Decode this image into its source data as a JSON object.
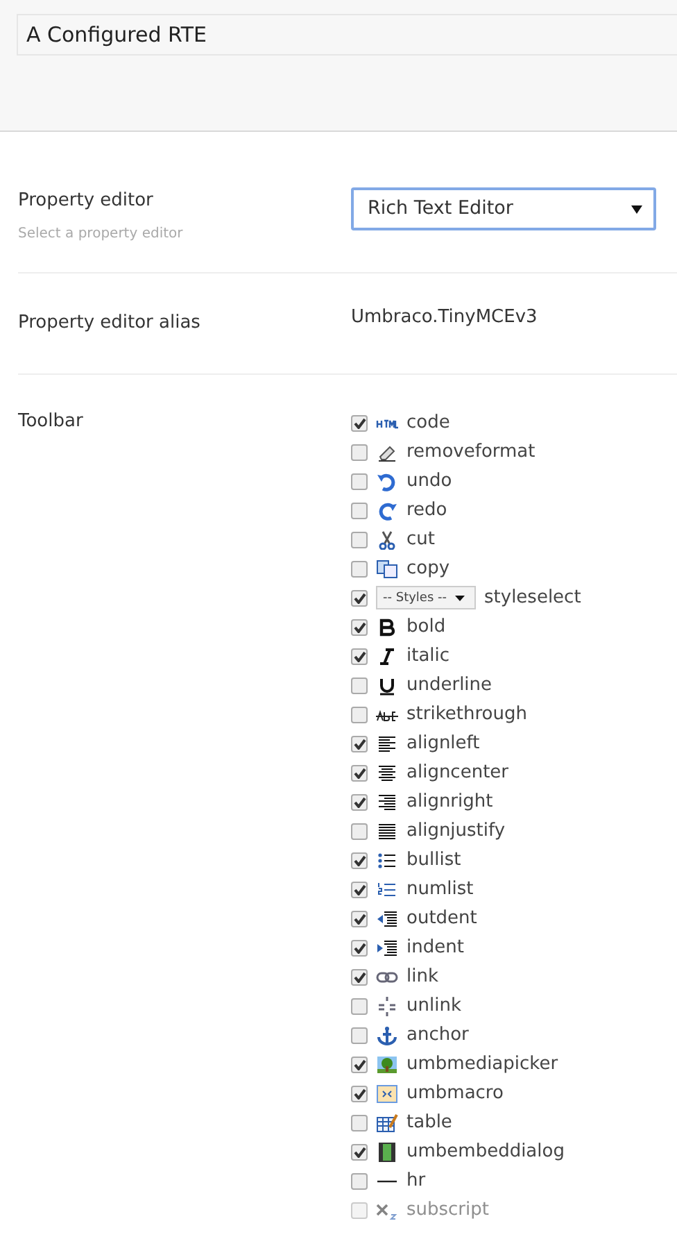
{
  "header": {
    "name_value": "A Configured RTE"
  },
  "property_editor": {
    "label": "Property editor",
    "description": "Select a property editor",
    "value": "Rich Text Editor"
  },
  "alias": {
    "label": "Property editor alias",
    "value": "Umbraco.TinyMCEv3"
  },
  "toolbar": {
    "label": "Toolbar",
    "items": [
      {
        "label": "code",
        "kind": "html",
        "checked": true
      },
      {
        "label": "removeformat",
        "kind": "eraser",
        "checked": false
      },
      {
        "label": "undo",
        "kind": "undo",
        "checked": false
      },
      {
        "label": "redo",
        "kind": "redo",
        "checked": false
      },
      {
        "label": "cut",
        "kind": "scissors",
        "checked": false
      },
      {
        "label": "copy",
        "kind": "copy",
        "checked": false
      },
      {
        "label": "styleselect",
        "kind": "select",
        "select_label": "-- Styles --",
        "checked": true
      },
      {
        "label": "bold",
        "kind": "bold",
        "checked": true
      },
      {
        "label": "italic",
        "kind": "italic",
        "checked": true
      },
      {
        "label": "underline",
        "kind": "underline",
        "checked": false
      },
      {
        "label": "strikethrough",
        "kind": "strike",
        "checked": false
      },
      {
        "label": "alignleft",
        "kind": "alignleft",
        "checked": true
      },
      {
        "label": "aligncenter",
        "kind": "aligncenter",
        "checked": true
      },
      {
        "label": "alignright",
        "kind": "alignright",
        "checked": true
      },
      {
        "label": "alignjustify",
        "kind": "alignjustify",
        "checked": false
      },
      {
        "label": "bullist",
        "kind": "bullist",
        "checked": true
      },
      {
        "label": "numlist",
        "kind": "numlist",
        "checked": true
      },
      {
        "label": "outdent",
        "kind": "outdent",
        "checked": true
      },
      {
        "label": "indent",
        "kind": "indent",
        "checked": true
      },
      {
        "label": "link",
        "kind": "link",
        "checked": true
      },
      {
        "label": "unlink",
        "kind": "unlink",
        "checked": false
      },
      {
        "label": "anchor",
        "kind": "anchor",
        "checked": false
      },
      {
        "label": "umbmediapicker",
        "kind": "image",
        "checked": true
      },
      {
        "label": "umbmacro",
        "kind": "macro",
        "checked": true
      },
      {
        "label": "table",
        "kind": "table",
        "checked": false
      },
      {
        "label": "umbembeddialog",
        "kind": "film",
        "checked": true
      },
      {
        "label": "hr",
        "kind": "hr",
        "checked": false
      },
      {
        "label": "subscript",
        "kind": "subscript",
        "checked": false
      }
    ]
  }
}
